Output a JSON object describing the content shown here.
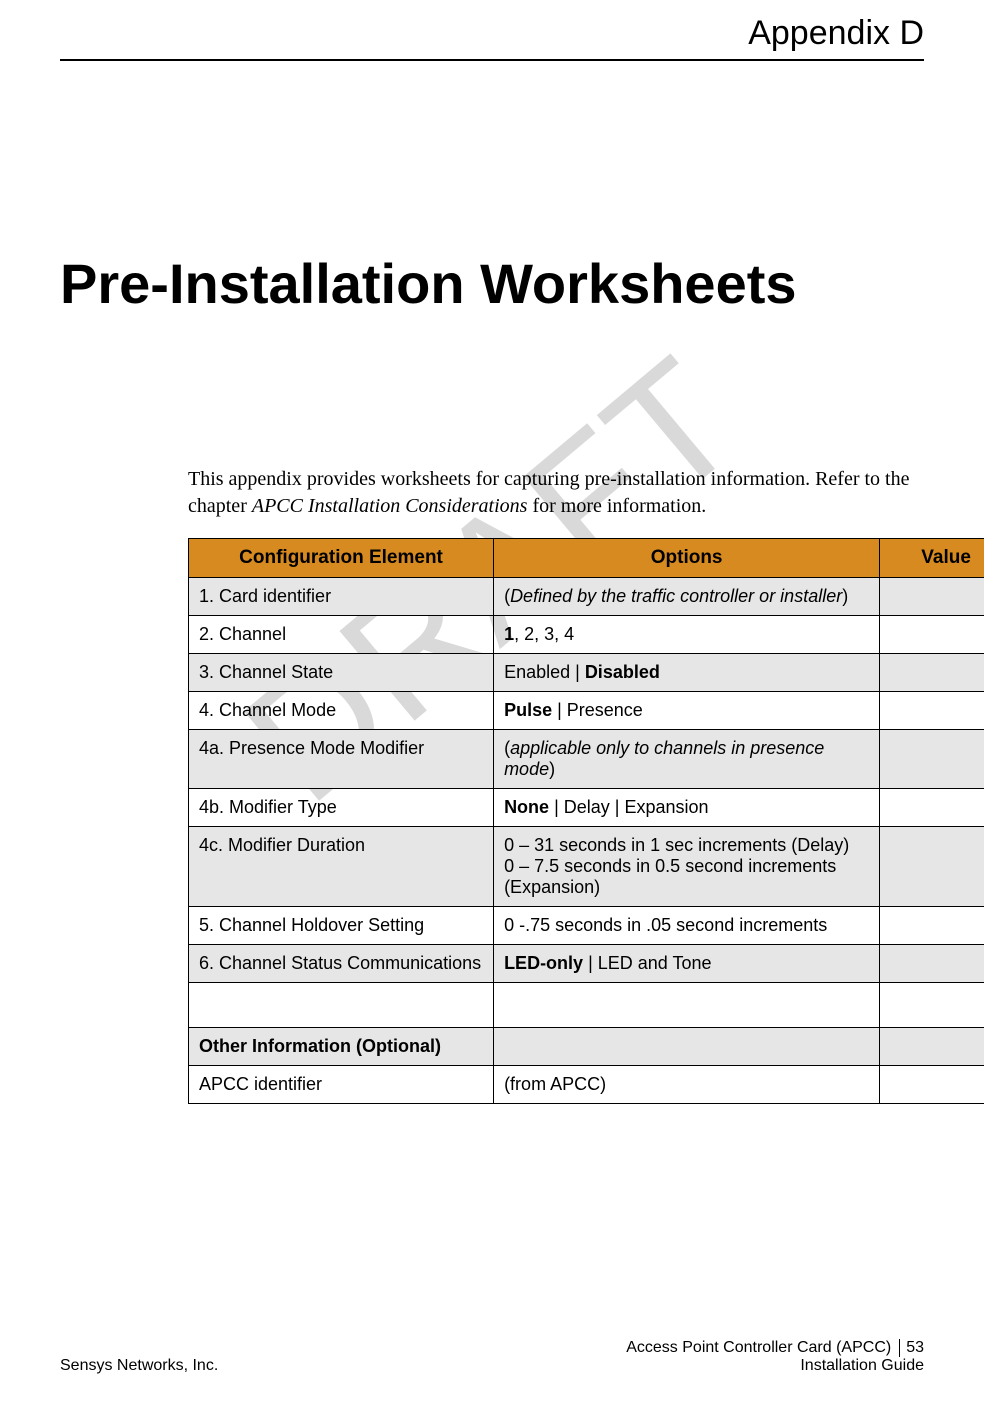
{
  "header": {
    "appendix": "Appendix D"
  },
  "watermark": "DRAFT",
  "title": "Pre-Installation Worksheets",
  "intro": {
    "prefix": "This appendix provides worksheets for capturing pre-installation information. Refer to the chapter ",
    "ital": "APCC Installation Considerations",
    "suffix": " for more information."
  },
  "table": {
    "headers": {
      "col1": "Configuration Element",
      "col2": "Options",
      "col3": "Value"
    },
    "rows": {
      "r1": {
        "element": "1. Card identifier",
        "opt_pre": "(",
        "opt_ital": "Defined by the traffic controller or installer",
        "opt_post": ")"
      },
      "r2": {
        "element": "2. Channel",
        "opt_bold": "1",
        "opt_rest": ", 2, 3, 4"
      },
      "r3": {
        "element": "3. Channel State",
        "opt_pre": "Enabled | ",
        "opt_bold": "Disabled"
      },
      "r4": {
        "element": "4. Channel Mode",
        "opt_bold": "Pulse",
        "opt_rest": " | Presence"
      },
      "r4a": {
        "element": "4a. Presence Mode Modifier",
        "opt_pre": "(",
        "opt_ital": "applicable only to channels in presence mode",
        "opt_post": ")"
      },
      "r4b": {
        "element": "4b. Modifier Type",
        "opt_bold": "None",
        "opt_rest": " | Delay | Expansion"
      },
      "r4c": {
        "element": "4c. Modifier Duration",
        "opt_line1": "0 – 31 seconds in 1 sec increments (Delay)",
        "opt_line2": "0 – 7.5 seconds in 0.5 second increments (Expansion)"
      },
      "r5": {
        "element": "5. Channel Holdover Setting",
        "opt": "0 -.75 seconds in .05 second incre­ments"
      },
      "r6": {
        "element": "6. Channel Status Communications",
        "opt_bold": "LED-only",
        "opt_rest": " | LED and Tone"
      },
      "section": {
        "label": "Other Information (Optional)"
      },
      "r7": {
        "element": "APCC identifier",
        "opt": "(from APCC)"
      }
    }
  },
  "footer": {
    "left": "Sensys Networks, Inc.",
    "right1": "Access Point Controller Card (APCC)",
    "pnum": "53",
    "right2": "Installation Guide"
  }
}
